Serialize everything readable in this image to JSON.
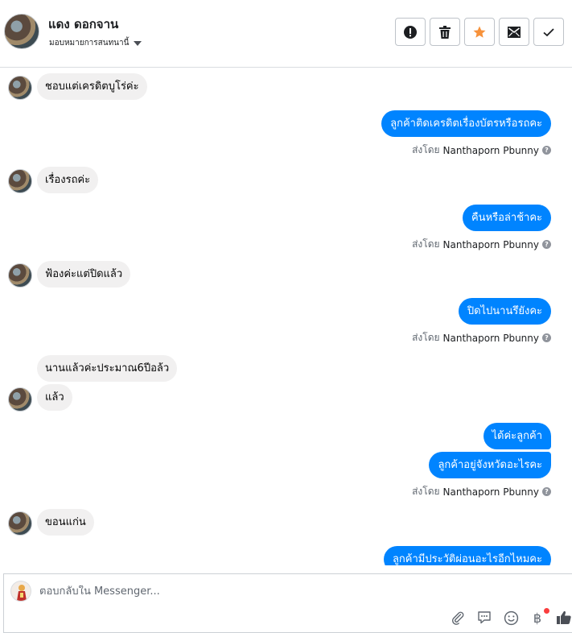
{
  "header": {
    "contact_name": "แดง ดอกจาน",
    "assign_label": "มอบหมายการสนทนานี้",
    "actions": [
      "mark-spam",
      "delete",
      "star",
      "move-to-inbox",
      "mark-done"
    ]
  },
  "messages": [
    {
      "dir": "in",
      "text": "ชอบแต่เครดิตบูโร่ค่ะ"
    },
    {
      "dir": "out",
      "text": "ลูกค้าติดเครดิตเรื่องบัตรหรือรถคะ"
    },
    {
      "dir": "in",
      "text": "เรื่องรถค่ะ"
    },
    {
      "dir": "out",
      "text": "คืนหรือล่าช้าคะ"
    },
    {
      "dir": "in",
      "text": "ฟ้องค่ะแต่ปิดแล้ว"
    },
    {
      "dir": "out",
      "text": "ปิดไปนานรึยังคะ"
    },
    {
      "dir": "in",
      "text": "นานแล้วค่ะประมาณ6ปีอล้ว"
    },
    {
      "dir": "in",
      "text": "แล้ว"
    },
    {
      "dir": "out",
      "text": "ได้ค่ะลูกค้า"
    },
    {
      "dir": "out",
      "text": "ลูกค้าอยู่จังหวัดอะไรคะ"
    },
    {
      "dir": "in",
      "text": "ขอนแก่น"
    },
    {
      "dir": "out",
      "text": "ลูกค้ามีประวัติผ่อนอะไรอีกไหมคะ"
    }
  ],
  "sent_by": {
    "prefix": "ส่งโดย",
    "agent": "Nanthaporn Pbunny"
  },
  "composer": {
    "placeholder": "ตอบกลับใน Messenger..."
  },
  "colors": {
    "outgoing": "#0084ff",
    "incoming": "#f1f0f0",
    "star": "#f7923b"
  }
}
